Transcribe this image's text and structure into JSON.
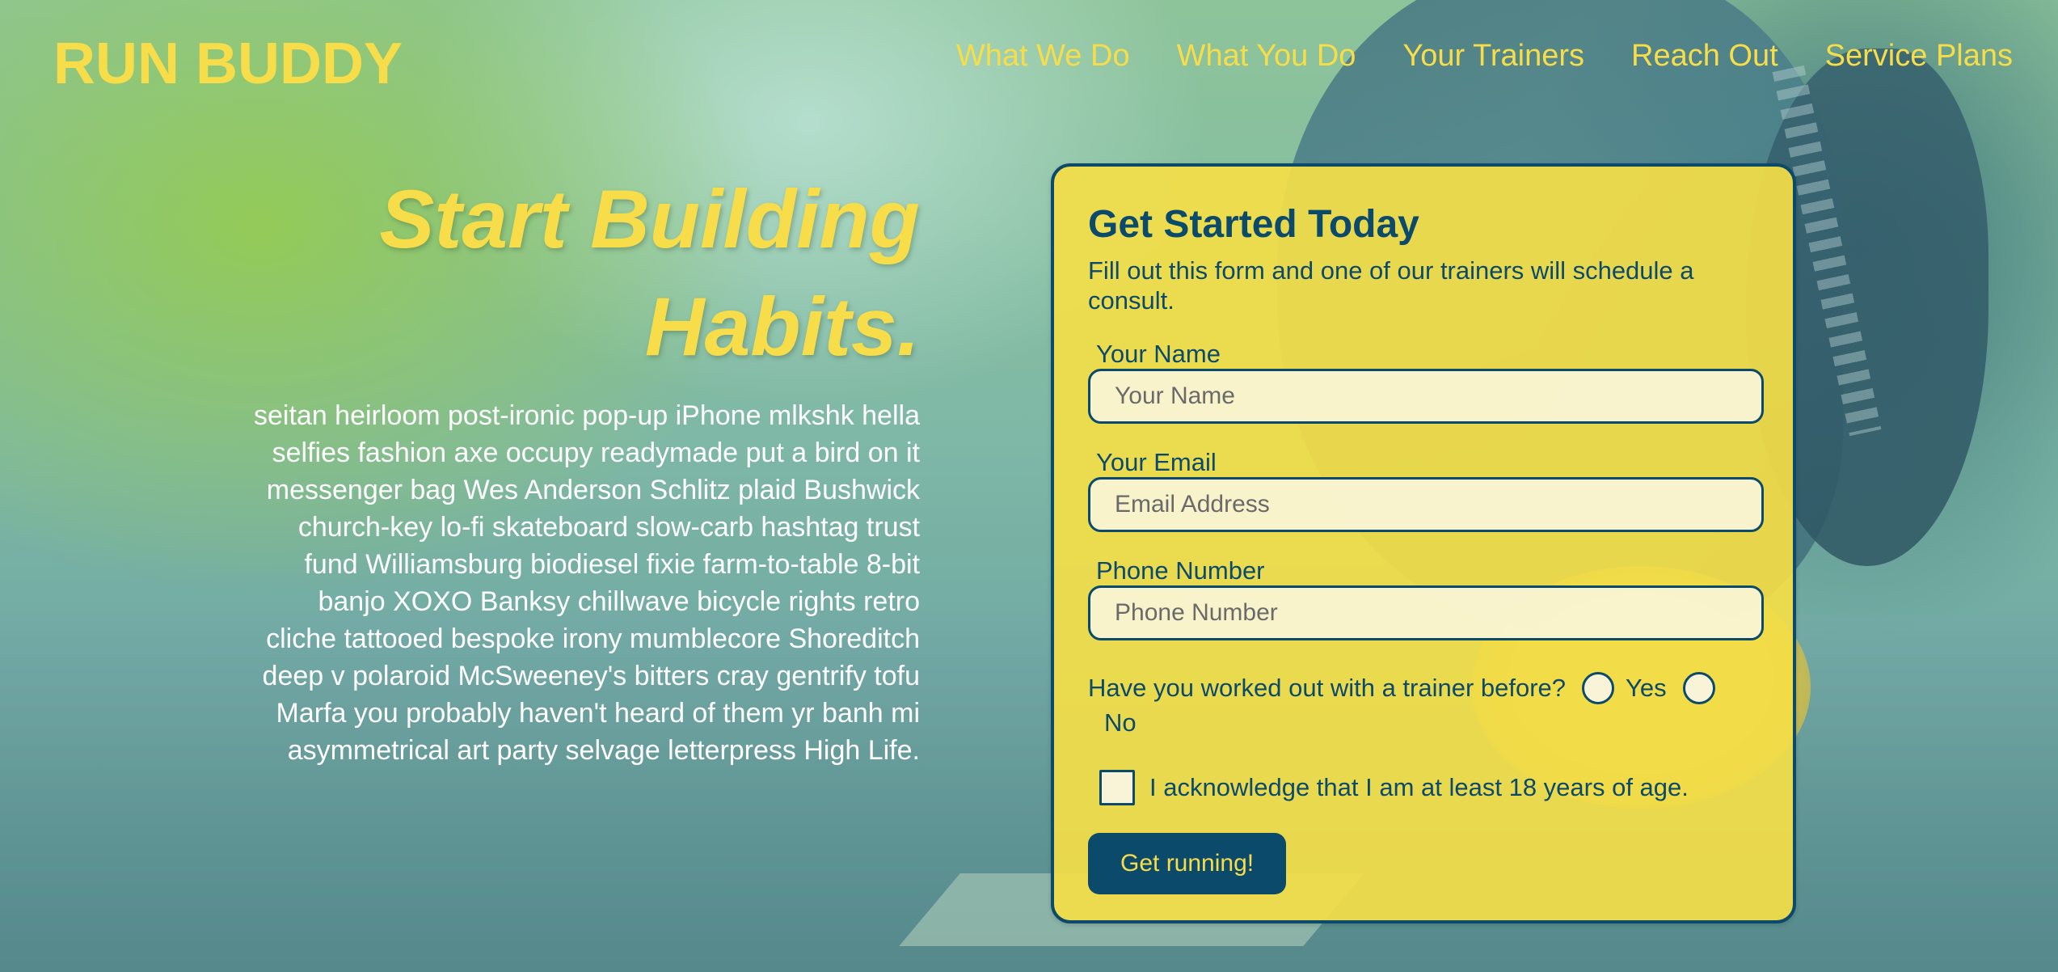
{
  "brand": {
    "logo": "RUN BUDDY",
    "accent": "#f7dd49",
    "primary": "#0c4a6b"
  },
  "nav": {
    "items": [
      {
        "label": "What We Do"
      },
      {
        "label": "What You Do"
      },
      {
        "label": "Your Trainers"
      },
      {
        "label": "Reach Out"
      },
      {
        "label": "Service Plans"
      }
    ]
  },
  "hero": {
    "title_line1": "Start Building",
    "title_line2": "Habits.",
    "body": "seitan heirloom post-ironic pop-up iPhone mlkshk hella selfies fashion axe occupy readymade put a bird on it messenger bag Wes Anderson Schlitz plaid Bushwick church-key lo-fi skateboard slow-carb hashtag trust fund Williamsburg biodiesel fixie farm-to-table 8-bit banjo XOXO Banksy chillwave bicycle rights retro cliche tattooed bespoke irony mumblecore Shoreditch deep v polaroid McSweeney's bitters cray gentrify tofu Marfa you probably haven't heard of them yr banh mi asymmetrical art party selvage letterpress High Life."
  },
  "form": {
    "title": "Get Started Today",
    "intro": "Fill out this form and one of our trainers will schedule a consult.",
    "name": {
      "label": "Your Name",
      "placeholder": "Your Name"
    },
    "email": {
      "label": "Your Email",
      "placeholder": "Email Address"
    },
    "phone": {
      "label": "Phone Number",
      "placeholder": "Phone Number"
    },
    "trainer_question": "Have you worked out with a trainer before?",
    "yes_label": "Yes",
    "no_label": "No",
    "age_ack": "I acknowledge that I am at least 18 years of age.",
    "submit_label": "Get running!"
  }
}
